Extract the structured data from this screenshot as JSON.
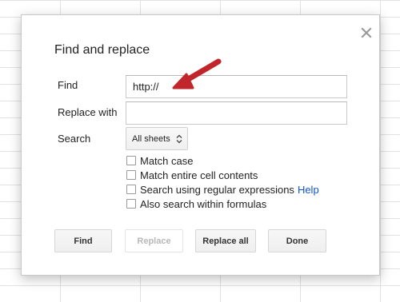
{
  "dialog": {
    "title": "Find and replace",
    "close_icon": "close-icon"
  },
  "find": {
    "label": "Find",
    "value": "http://"
  },
  "replace": {
    "label": "Replace with",
    "value": ""
  },
  "search": {
    "label": "Search",
    "selected": "All sheets"
  },
  "options": [
    {
      "label": "Match case",
      "checked": false
    },
    {
      "label": "Match entire cell contents",
      "checked": false
    },
    {
      "label": "Search using regular expressions",
      "checked": false,
      "link": "Help"
    },
    {
      "label": "Also search within formulas",
      "checked": false
    }
  ],
  "buttons": {
    "find": "Find",
    "replace": "Replace",
    "replace_all": "Replace all",
    "done": "Done"
  },
  "colors": {
    "link": "#1155cc",
    "annotation_arrow": "#c0262b"
  }
}
